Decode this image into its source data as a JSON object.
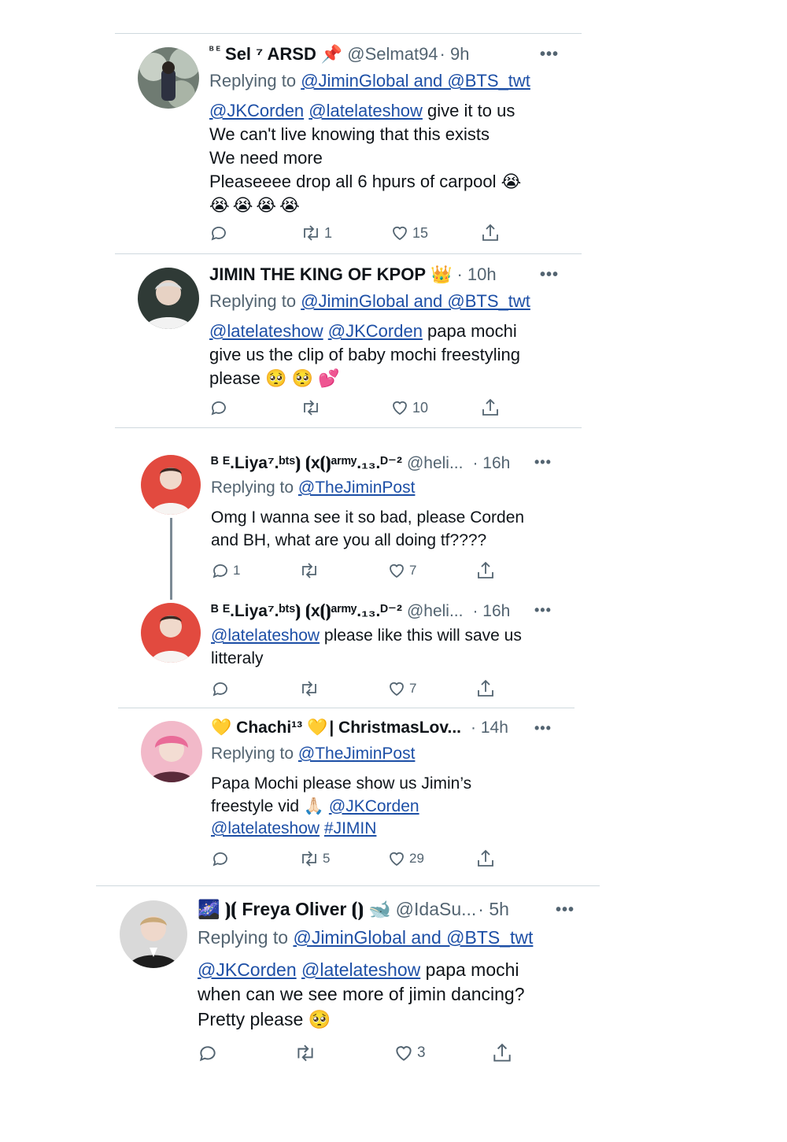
{
  "tweets": [
    {
      "name_sup": "ᴮ ᴱ",
      "name": "Sel ⁷ ARSD",
      "name_emoji": "📌",
      "handle": "@Selmat94",
      "time": "· 9h",
      "reply_prefix": "Replying to",
      "reply_targets": "@JiminGlobal and @BTS_twt",
      "mention1": "@JKCorden",
      "mention2": "@latelateshow",
      "line1_rest": " give it to us",
      "line2": "We can't live knowing that this exists",
      "line3": "We need more",
      "line4": "Pleaseeee drop all 6 hpurs of carpool",
      "emoji_line": "😭😭😭😭",
      "line4_emoji": "😭",
      "replies": "",
      "retweets": "1",
      "likes": "15"
    },
    {
      "name": "JIMIN THE KING OF KPOP",
      "name_emoji": "👑",
      "time": "· 10h",
      "reply_prefix": "Replying to",
      "reply_targets": "@JiminGlobal and @BTS_twt",
      "mention1": "@latelateshow",
      "mention2": "@JKCorden",
      "line1_rest": " papa mochi",
      "line2": "give us the clip of baby mochi freestyling",
      "line3": "please",
      "line3_emoji": "🥺 🥺 💕",
      "replies": "",
      "retweets": "",
      "likes": "10"
    },
    {
      "name": "ᴮ ᴱ.Liya⁷.ᵇᵗˢ⦘ ⦗x⦗⦘ᵃʳᵐʸ.₁₃.ᴰ⁻²",
      "handle": "@heli...",
      "time": "· 16h",
      "reply_prefix": "Replying to",
      "reply_targets": "@TheJiminPost",
      "line1": "Omg I wanna see it so bad, please Corden",
      "line2": "and BH, what are you all doing tf????",
      "replies": "1",
      "retweets": "",
      "likes": "7"
    },
    {
      "name": "ᴮ ᴱ.Liya⁷.ᵇᵗˢ⦘ ⦗x⦗⦘ᵃʳᵐʸ.₁₃.ᴰ⁻²",
      "handle": "@heli...",
      "time": "· 16h",
      "mention1": "@latelateshow",
      "line1_rest": " please like this will save us",
      "line2": "litteraly",
      "replies": "",
      "retweets": "",
      "likes": "7"
    },
    {
      "name_emoji_before": "💛",
      "name": "Chachi¹³",
      "name_emoji": "💛",
      "name_rest": "| ChristmasLov...",
      "time": "· 14h",
      "reply_prefix": "Replying to",
      "reply_targets": "@TheJiminPost",
      "line1": "Papa Mochi please show us Jimin’s",
      "line2": "freestyle vid",
      "line2_emoji": "🙏🏻",
      "mention1": "@JKCorden",
      "mention2": "@latelateshow",
      "hashtag": "#JIMIN",
      "replies": "",
      "retweets": "5",
      "likes": "29"
    },
    {
      "name_emoji_before": "🌌",
      "name": "⦘⦗ Freya Oliver ⦗⦘",
      "name_emoji": "🐋",
      "handle": "@IdaSu...",
      "time": "· 5h",
      "reply_prefix": "Replying to",
      "reply_targets": "@JiminGlobal and @BTS_twt",
      "mention1": "@JKCorden",
      "mention2": "@latelateshow",
      "line1_rest": " papa mochi",
      "line2": "when can we see more of jimin dancing?",
      "line3": "Pretty please",
      "line3_emoji": "🥺",
      "replies": "",
      "retweets": "",
      "likes": "3"
    }
  ],
  "colors": {
    "link": "#1d4fa6",
    "muted": "#536471",
    "divider": "#cfd9de"
  },
  "icons": [
    "reply-icon",
    "retweet-icon",
    "like-icon",
    "share-icon",
    "more-icon"
  ]
}
